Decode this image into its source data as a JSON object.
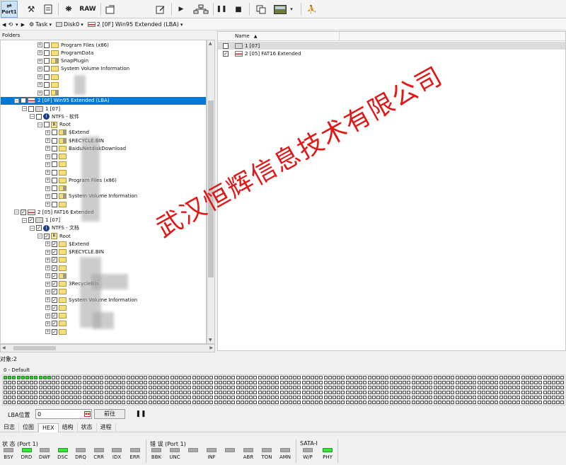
{
  "toolbar": {
    "port_label": "Port1",
    "raw_label": "RAW"
  },
  "address_bar": {
    "task_label": "Task",
    "disk_label": "Disk0",
    "partition_label": "2 [0F] Win95 Extended  (LBA)"
  },
  "folders": {
    "header": "Folders",
    "rows": [
      {
        "text": "Program Files (x86)",
        "level": 6,
        "expander": "+",
        "icon": "folder",
        "checked": false
      },
      {
        "text": "ProgramData",
        "level": 6,
        "expander": "+",
        "icon": "folder",
        "checked": false
      },
      {
        "text": "SnapPlugin",
        "level": 6,
        "expander": "+",
        "icon": "folder-sys",
        "checked": false
      },
      {
        "text": "System Volume Information",
        "level": 6,
        "expander": "+",
        "icon": "folder",
        "checked": false
      },
      {
        "text": "",
        "level": 6,
        "expander": "+",
        "icon": "folder",
        "checked": false
      },
      {
        "text": "",
        "level": 6,
        "expander": "+",
        "icon": "folder",
        "checked": false
      },
      {
        "text": "",
        "level": 6,
        "expander": "+",
        "icon": "folder-sys",
        "checked": false
      },
      {
        "text": "2 [0F] Win95 Extended  (LBA)",
        "level": 3,
        "expander": "-",
        "icon": "part",
        "checked": false,
        "selected": true
      },
      {
        "text": "1 [07]",
        "level": 4,
        "expander": "-",
        "icon": "disk",
        "checked": false
      },
      {
        "text": "NTFS - 软件",
        "level": 5,
        "expander": "-",
        "icon": "ntfs",
        "checked": false
      },
      {
        "text": "Root",
        "level": 6,
        "expander": "-",
        "icon": "root",
        "checked": false
      },
      {
        "text": "$Extend",
        "level": 7,
        "expander": "+",
        "icon": "folder-sys",
        "checked": false
      },
      {
        "text": "$RECYCLE.BIN",
        "level": 7,
        "expander": "+",
        "icon": "folder-sys",
        "checked": false
      },
      {
        "text": "BaiduNetdiskDownload",
        "level": 7,
        "expander": "+",
        "icon": "folder",
        "checked": false
      },
      {
        "text": "",
        "level": 7,
        "expander": "+",
        "icon": "folder",
        "checked": false
      },
      {
        "text": "",
        "level": 7,
        "expander": "+",
        "icon": "folder",
        "checked": false
      },
      {
        "text": "",
        "level": 7,
        "expander": "+",
        "icon": "folder",
        "checked": false
      },
      {
        "text": "Program Files (x86)",
        "level": 7,
        "expander": "+",
        "icon": "folder",
        "checked": false
      },
      {
        "text": "",
        "level": 7,
        "expander": "+",
        "icon": "folder-sys",
        "checked": false
      },
      {
        "text": "System Volume Information",
        "level": 7,
        "expander": "+",
        "icon": "folder-sys",
        "checked": false
      },
      {
        "text": "",
        "level": 7,
        "expander": "+",
        "icon": "folder",
        "checked": false
      },
      {
        "text": "2 [05] FAT16 Extended",
        "level": 3,
        "expander": "-",
        "icon": "part",
        "checked": true
      },
      {
        "text": "1 [07]",
        "level": 4,
        "expander": "-",
        "icon": "disk",
        "checked": true
      },
      {
        "text": "NTFS - 文档",
        "level": 5,
        "expander": "-",
        "icon": "ntfs",
        "checked": true
      },
      {
        "text": "Root",
        "level": 6,
        "expander": "-",
        "icon": "root",
        "checked": true
      },
      {
        "text": "$Extend",
        "level": 7,
        "expander": "+",
        "icon": "folder",
        "checked": true
      },
      {
        "text": "$RECYCLE.BIN",
        "level": 7,
        "expander": "+",
        "icon": "folder",
        "checked": true
      },
      {
        "text": "",
        "level": 7,
        "expander": "+",
        "icon": "folder",
        "checked": true
      },
      {
        "text": "",
        "level": 7,
        "expander": "+",
        "icon": "folder",
        "checked": true
      },
      {
        "text": "",
        "level": 7,
        "expander": "+",
        "icon": "folder-sys",
        "checked": true
      },
      {
        "text": "3RecycleBin",
        "level": 7,
        "expander": "+",
        "icon": "folder",
        "checked": true
      },
      {
        "text": "",
        "level": 7,
        "expander": "+",
        "icon": "folder",
        "checked": true
      },
      {
        "text": "System Volume Information",
        "level": 7,
        "expander": "+",
        "icon": "folder",
        "checked": true
      },
      {
        "text": "",
        "level": 7,
        "expander": "+",
        "icon": "folder",
        "checked": true
      },
      {
        "text": "",
        "level": 7,
        "expander": "+",
        "icon": "folder",
        "checked": true
      },
      {
        "text": "",
        "level": 7,
        "expander": "+",
        "icon": "folder",
        "checked": true
      },
      {
        "text": "",
        "level": 7,
        "expander": "+",
        "icon": "folder",
        "checked": true
      }
    ]
  },
  "list": {
    "name_header": "Name",
    "rows": [
      {
        "text": "1 [07]",
        "icon": "disk",
        "checked": false,
        "selected": true
      },
      {
        "text": "2 [05] FAT16 Extended",
        "icon": "part",
        "checked": true,
        "selected": false
      }
    ]
  },
  "status": {
    "object_count": "对象:2",
    "group_label": "0 - Default",
    "blocks_filled": 11
  },
  "lba": {
    "label": "LBA位置",
    "value": "0",
    "goto_label": "前往"
  },
  "tabs": [
    "日志",
    "位图",
    "HEX",
    "结构",
    "状态",
    "进程"
  ],
  "indicators": {
    "status": {
      "title": "状 态 (Port 1)",
      "leds": [
        {
          "label": "BSY",
          "on": false
        },
        {
          "label": "DRD",
          "on": true
        },
        {
          "label": "DWF",
          "on": false
        },
        {
          "label": "DSC",
          "on": true
        },
        {
          "label": "DRQ",
          "on": false
        },
        {
          "label": "CRR",
          "on": false
        },
        {
          "label": "IDX",
          "on": false
        },
        {
          "label": "ERR",
          "on": false
        }
      ]
    },
    "errors": {
      "title": "错 误 (Port 1)",
      "leds": [
        {
          "label": "BBK",
          "on": false
        },
        {
          "label": "UNC",
          "on": false
        },
        {
          "label": "",
          "on": false
        },
        {
          "label": "INF",
          "on": false
        },
        {
          "label": "",
          "on": false
        },
        {
          "label": "ABR",
          "on": false
        },
        {
          "label": "TON",
          "on": false
        },
        {
          "label": "AMN",
          "on": false
        }
      ]
    },
    "sata": {
      "title": "SATA-I",
      "leds": [
        {
          "label": "W/P",
          "on": false
        },
        {
          "label": "PHY",
          "on": true
        }
      ]
    }
  },
  "watermark": "武汉恒辉信息技术有限公司",
  "colors": {
    "selection": "#0078d7",
    "led_on": "#38e838",
    "watermark": "#e01818"
  }
}
